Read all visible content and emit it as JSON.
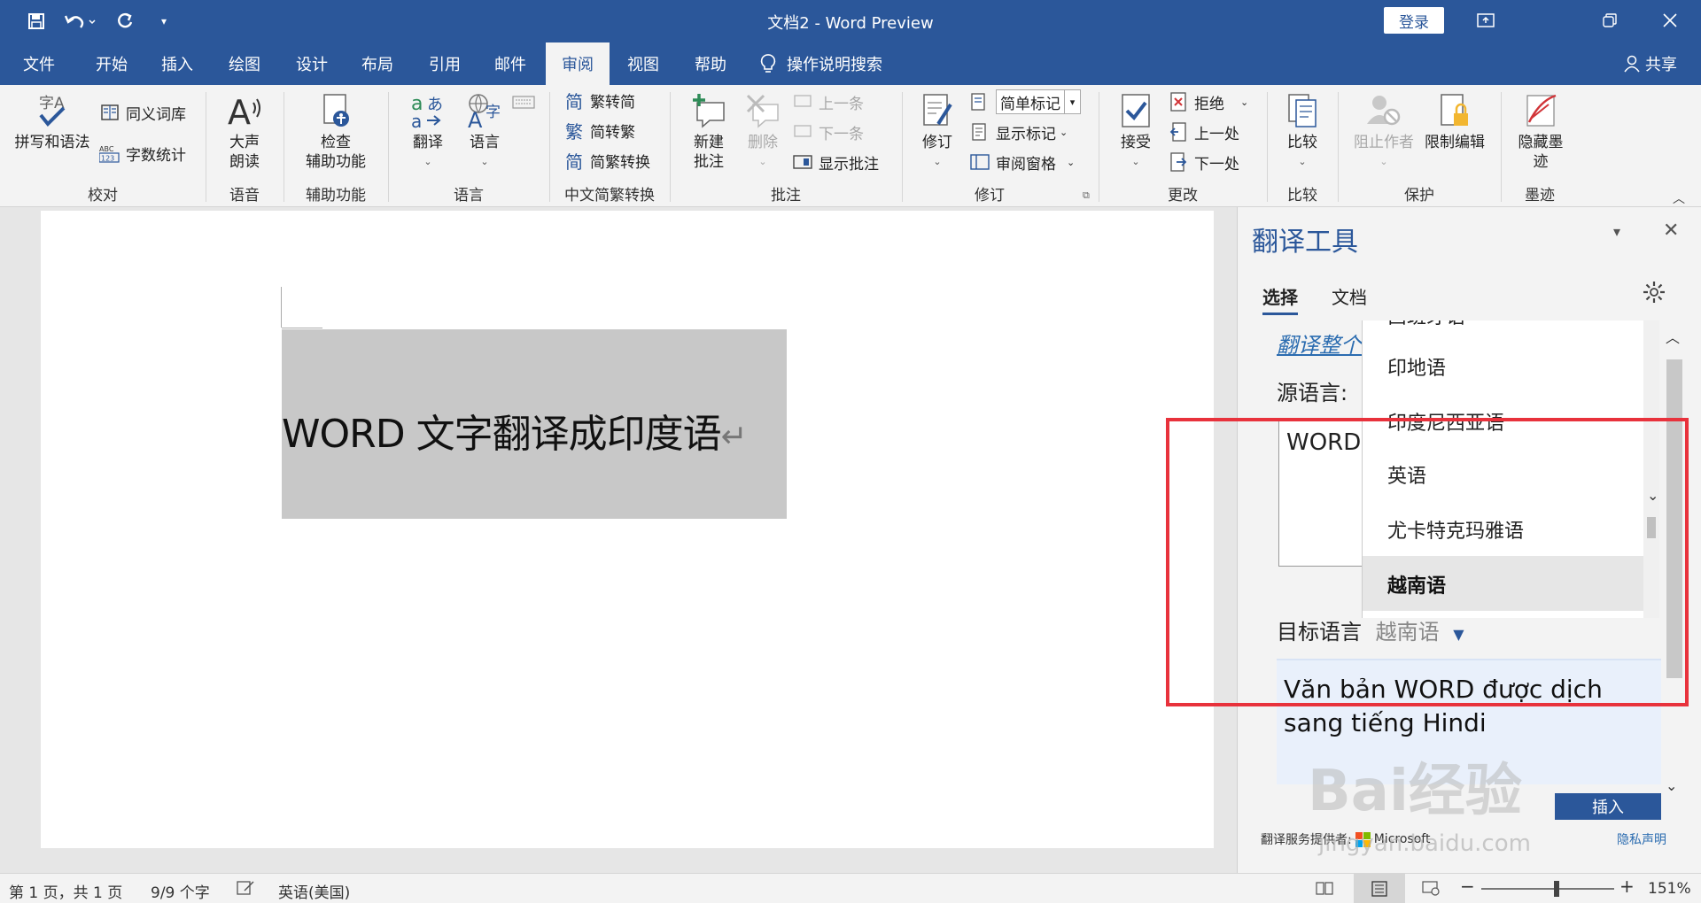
{
  "titlebar": {
    "title": "文档2  -  Word Preview",
    "login_label": "登录",
    "qat_icons": [
      "save-icon",
      "undo-icon",
      "redo-icon",
      "customize-qat-icon"
    ],
    "window_icons": [
      "ribbon-display-icon",
      "restore-icon",
      "close-icon"
    ]
  },
  "tabs": {
    "items": [
      "文件",
      "开始",
      "插入",
      "绘图",
      "设计",
      "布局",
      "引用",
      "邮件",
      "审阅",
      "视图",
      "帮助"
    ],
    "active": "审阅",
    "tell_me": "操作说明搜索",
    "share": "共享"
  },
  "ribbon": {
    "proofing": {
      "spelling": "拼写和语法",
      "thesaurus": "同义词库",
      "word_count": "字数统计",
      "label": "校对"
    },
    "speech": {
      "read_aloud": "大声\n朗读",
      "label": "语音"
    },
    "accessibility": {
      "check": "检查\n辅助功能",
      "label": "辅助功能"
    },
    "language": {
      "translate": "翻译",
      "language": "语言",
      "label": "语言"
    },
    "chinese": {
      "t2s": "繁转简",
      "s2t": "简转繁",
      "convert": "简繁转换",
      "label": "中文简繁转换"
    },
    "comments": {
      "new": "新建\n批注",
      "delete": "删除",
      "prev": "上一条",
      "next": "下一条",
      "show": "显示批注",
      "label": "批注"
    },
    "tracking": {
      "track": "修订",
      "markup_value": "简单标记",
      "show_markup": "显示标记",
      "review_pane": "审阅窗格",
      "label": "修订"
    },
    "changes": {
      "accept": "接受",
      "reject": "拒绝",
      "prev": "上一处",
      "next": "下一处",
      "label": "更改"
    },
    "compare": {
      "compare": "比较",
      "label": "比较"
    },
    "protect": {
      "block": "阻止作者",
      "restrict": "限制编辑",
      "label": "保护"
    },
    "ink": {
      "hide": "隐藏墨\n迹",
      "label": "墨迹"
    }
  },
  "document": {
    "selected_text": "WORD 文字翻译成印度语"
  },
  "translator": {
    "title": "翻译工具",
    "tab_selection": "选择",
    "tab_document": "文档",
    "translate_all_link": "翻译整个",
    "source_label": "源语言:",
    "source_text": "WORD",
    "dropdown_items": [
      "西班牙语",
      "印地语",
      "印度尼西亚语",
      "英语",
      "尤卡特克玛雅语",
      "越南语"
    ],
    "dropdown_selected": "越南语",
    "target_label": "目标语言",
    "target_value": "越南语",
    "translated_text": "Văn bản WORD được dịch sang tiếng Hindi",
    "insert_label": "插入",
    "provider_label": "翻译服务提供者:",
    "provider_name": "Microsoft",
    "privacy_label": "隐私声明",
    "highlight_color": "#e8323c"
  },
  "status": {
    "page": "第 1 页，共 1 页",
    "words": "9/9 个字",
    "language": "英语(美国)",
    "zoom": "151%"
  },
  "watermark": {
    "text": "Bai经验",
    "url": "jingyan.baidu.com"
  }
}
